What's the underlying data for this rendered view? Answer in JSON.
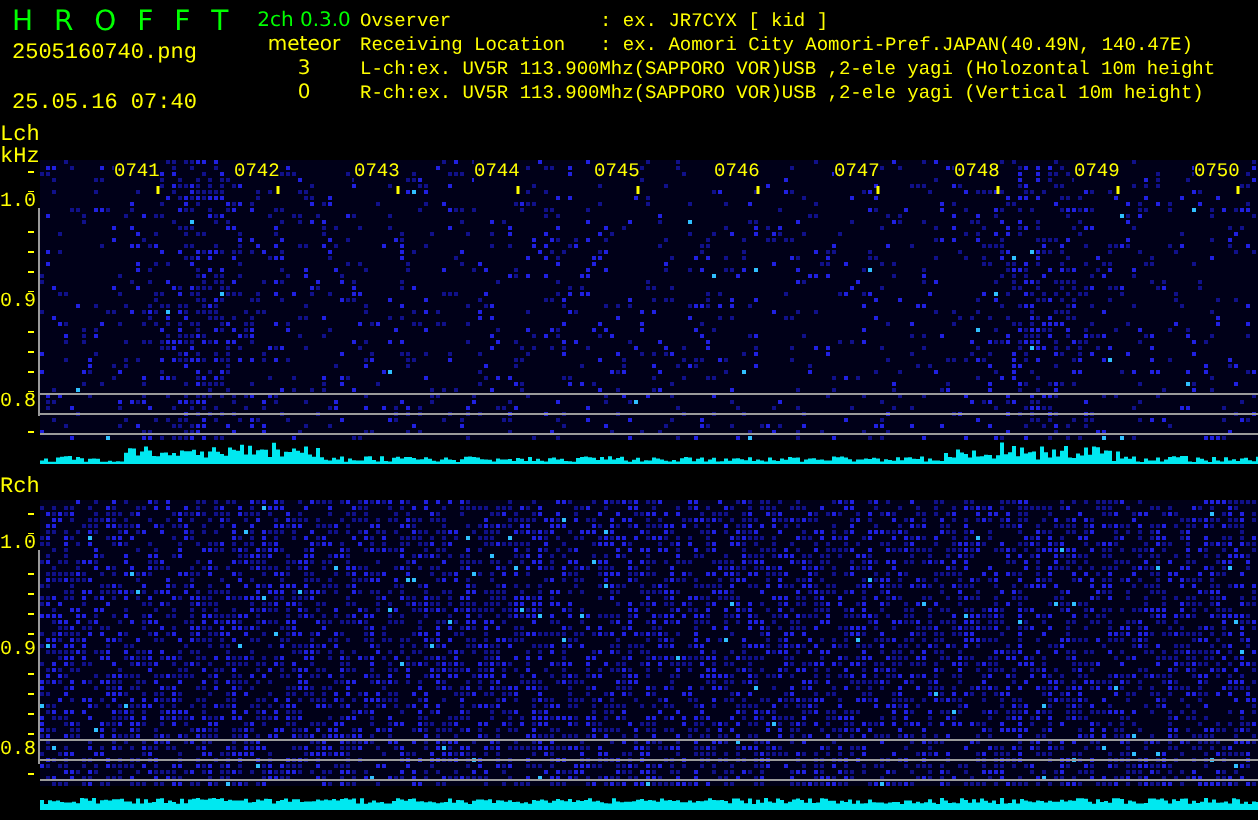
{
  "header": {
    "app_name": "H R O F F T",
    "version": "2ch 0.3.0",
    "file_name": "2505160740.png",
    "mode": "meteor",
    "datetime": "25.05.16 07:40",
    "counts": [
      "3",
      "0"
    ]
  },
  "info": [
    {
      "label": "Ovserver",
      "value": ": ex. JR7CYX [ kid ]"
    },
    {
      "label": "Receiving Location",
      "value": ": ex. Aomori City Aomori-Pref.JAPAN(40.49N, 140.47E)"
    }
  ],
  "channel_lines": [
    "L-ch:ex. UV5R 113.900Mhz(SAPPORO VOR)USB ,2-ele yagi (Holozontal 10m height",
    "R-ch:ex. UV5R 113.900Mhz(SAPPORO VOR)USB ,2-ele yagi (Vertical 10m height)"
  ],
  "panels": [
    {
      "label": "Lch",
      "unit": "kHz",
      "time_labels": [
        "0741",
        "0742",
        "0743",
        "0744",
        "0745",
        "0746",
        "0747",
        "0748",
        "0749",
        "0750"
      ],
      "freq_labels": [
        "1.0",
        "0.9",
        "0.8"
      ]
    },
    {
      "label": "Rch",
      "freq_labels": [
        "1.0",
        "0.9",
        "0.8"
      ]
    }
  ]
}
